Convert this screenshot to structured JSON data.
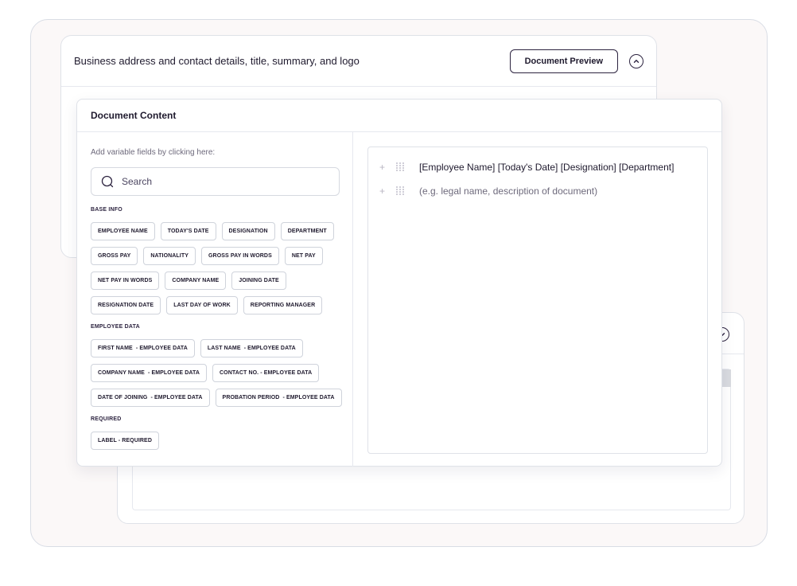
{
  "back_card": {
    "title": "Business address and contact details, title, summary, and logo",
    "preview_button": "Document Preview"
  },
  "main_card": {
    "title": "Document Content"
  },
  "variables": {
    "hint": "Add variable fields by clicking here:",
    "search_placeholder": "Search",
    "sections": [
      {
        "label": "BASE INFO",
        "chips": [
          "EMPLOYEE NAME",
          "TODAY'S DATE",
          "DESIGNATION",
          "DEPARTMENT",
          "GROSS PAY",
          "NATIONALITY",
          "GROSS PAY IN WORDS",
          "NET PAY",
          "NET PAY IN WORDS",
          "COMPANY NAME",
          "JOINING DATE",
          "RESIGNATION DATE",
          "LAST DAY OF WORK",
          "REPORTING MANAGER"
        ]
      },
      {
        "label": "EMPLOYEE DATA",
        "chips": [
          "FIRST NAME  - EMPLOYEE DATA",
          "LAST NAME  - EMPLOYEE DATA",
          "COMPANY NAME  - EMPLOYEE DATA",
          "CONTACT NO. - EMPLOYEE DATA",
          "DATE OF JOINING  - EMPLOYEE DATA",
          "PROBATION PERIOD  - EMPLOYEE DATA"
        ]
      },
      {
        "label": "REQUIRED",
        "chips": [
          "LABEL - REQUIRED"
        ]
      }
    ]
  },
  "editor": {
    "lines": [
      {
        "text": "[Employee Name] [Today's Date] [Designation] [Department]",
        "placeholder": false
      },
      {
        "text": "(e.g. legal name, description of document)",
        "placeholder": true
      }
    ]
  },
  "colors": {
    "accent": "#2d2440",
    "border": "#dfe2e8",
    "frame_bg": "#fbf8f8"
  }
}
